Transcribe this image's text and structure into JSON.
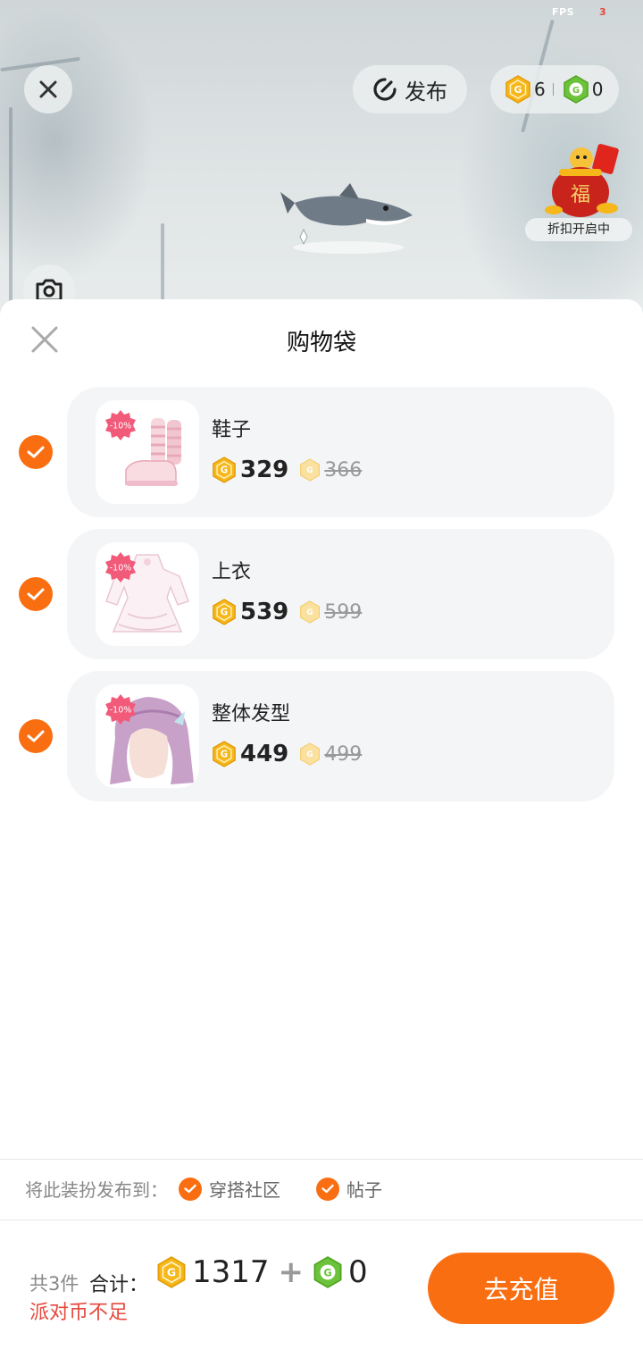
{
  "status": {
    "fps_label": "FPS",
    "fps_value": "3"
  },
  "top_bar": {
    "publish_label": "发布",
    "gold_coins": "6",
    "green_coins": "0"
  },
  "event": {
    "label": "折扣开启中"
  },
  "sheet": {
    "title": "购物袋",
    "items": [
      {
        "name": "鞋子",
        "price": "329",
        "original_price": "366",
        "discount": "-10%"
      },
      {
        "name": "上衣",
        "price": "539",
        "original_price": "599",
        "discount": "-10%"
      },
      {
        "name": "整体发型",
        "price": "449",
        "original_price": "499",
        "discount": "-10%"
      }
    ],
    "publish_to_label": "将此装扮发布到：",
    "publish_options": [
      "穿搭社区",
      "帖子"
    ]
  },
  "footer": {
    "count": "共3件",
    "total_label": "合计：",
    "gold_total": "1317",
    "plus": "+",
    "green_total": "0",
    "warning": "派对币不足",
    "recharge_label": "去充值"
  },
  "colors": {
    "accent": "#fa6e12",
    "warning": "#e5483c",
    "gold": "#f6b71a",
    "green": "#6cc23a"
  }
}
